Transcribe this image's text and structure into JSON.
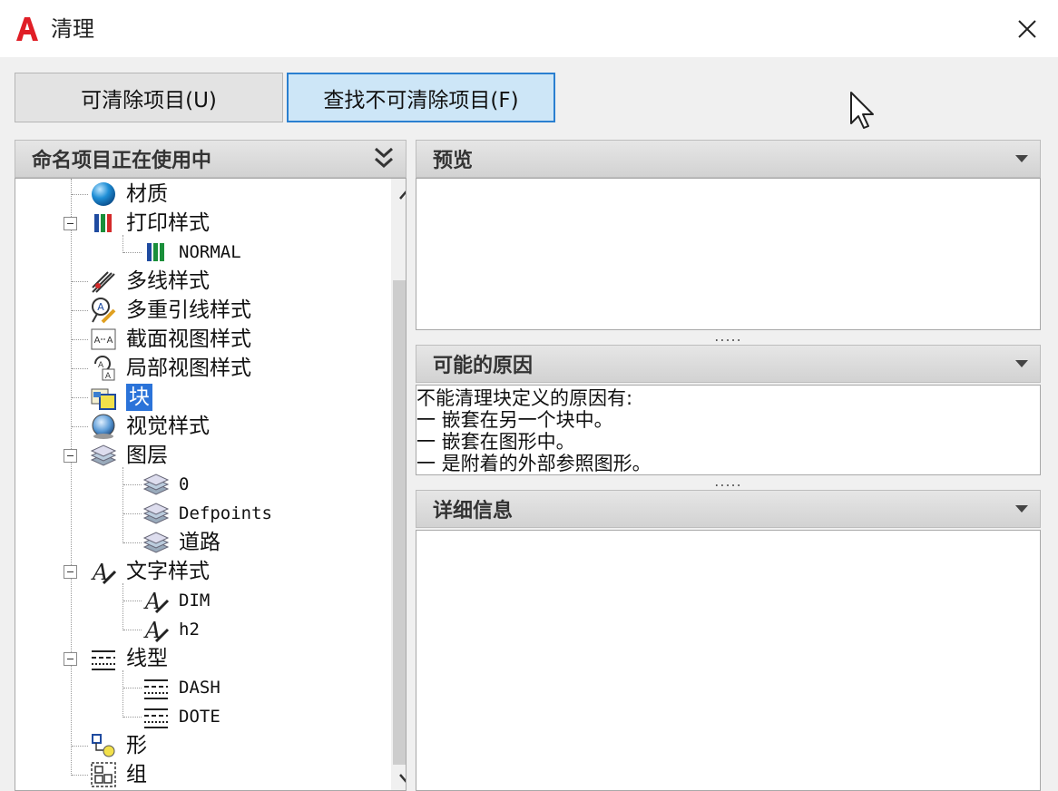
{
  "window": {
    "title": "清理",
    "brand_color": "#e01e26"
  },
  "tabs": [
    {
      "label": "可清除项目(U)",
      "active": false
    },
    {
      "label": "查找不可清除项目(F)",
      "active": true
    }
  ],
  "left_pane": {
    "header": "命名项目正在使用中"
  },
  "tree": {
    "items": [
      {
        "label": "材质",
        "icon": "material-icon"
      },
      {
        "label": "打印样式",
        "icon": "plot-style-icon"
      },
      {
        "label": "NORMAL",
        "icon": "plot-style-icon"
      },
      {
        "label": "多线样式",
        "icon": "multiline-style-icon"
      },
      {
        "label": "多重引线样式",
        "icon": "multileader-style-icon"
      },
      {
        "label": "截面视图样式",
        "icon": "section-view-style-icon"
      },
      {
        "label": "局部视图样式",
        "icon": "detail-view-style-icon"
      },
      {
        "label": "块",
        "icon": "block-icon",
        "selected": true
      },
      {
        "label": "视觉样式",
        "icon": "visual-style-icon"
      },
      {
        "label": "图层",
        "icon": "layer-icon"
      },
      {
        "label": "0",
        "icon": "layer-icon"
      },
      {
        "label": "Defpoints",
        "icon": "layer-icon"
      },
      {
        "label": "道路",
        "icon": "layer-icon"
      },
      {
        "label": "文字样式",
        "icon": "text-style-icon"
      },
      {
        "label": "DIM",
        "icon": "text-style-icon"
      },
      {
        "label": "h2",
        "icon": "text-style-icon"
      },
      {
        "label": "线型",
        "icon": "linetype-icon"
      },
      {
        "label": "DASH",
        "icon": "linetype-icon"
      },
      {
        "label": "DOTE",
        "icon": "linetype-icon"
      },
      {
        "label": "形",
        "icon": "shape-icon"
      },
      {
        "label": "组",
        "icon": "group-icon"
      }
    ]
  },
  "panels": {
    "preview": {
      "title": "预览"
    },
    "reasons": {
      "title": "可能的原因",
      "lines": [
        "不能清理块定义的原因有:",
        "一 嵌套在另一个块中。",
        "一 嵌套在图形中。",
        "一 是附着的外部参照图形。"
      ]
    },
    "details": {
      "title": "详细信息"
    },
    "splitter_grip": "....."
  },
  "colors": {
    "selection": "#2b73d9",
    "active_tab_bg": "#cde6f7",
    "active_tab_border": "#2a7fd0"
  }
}
